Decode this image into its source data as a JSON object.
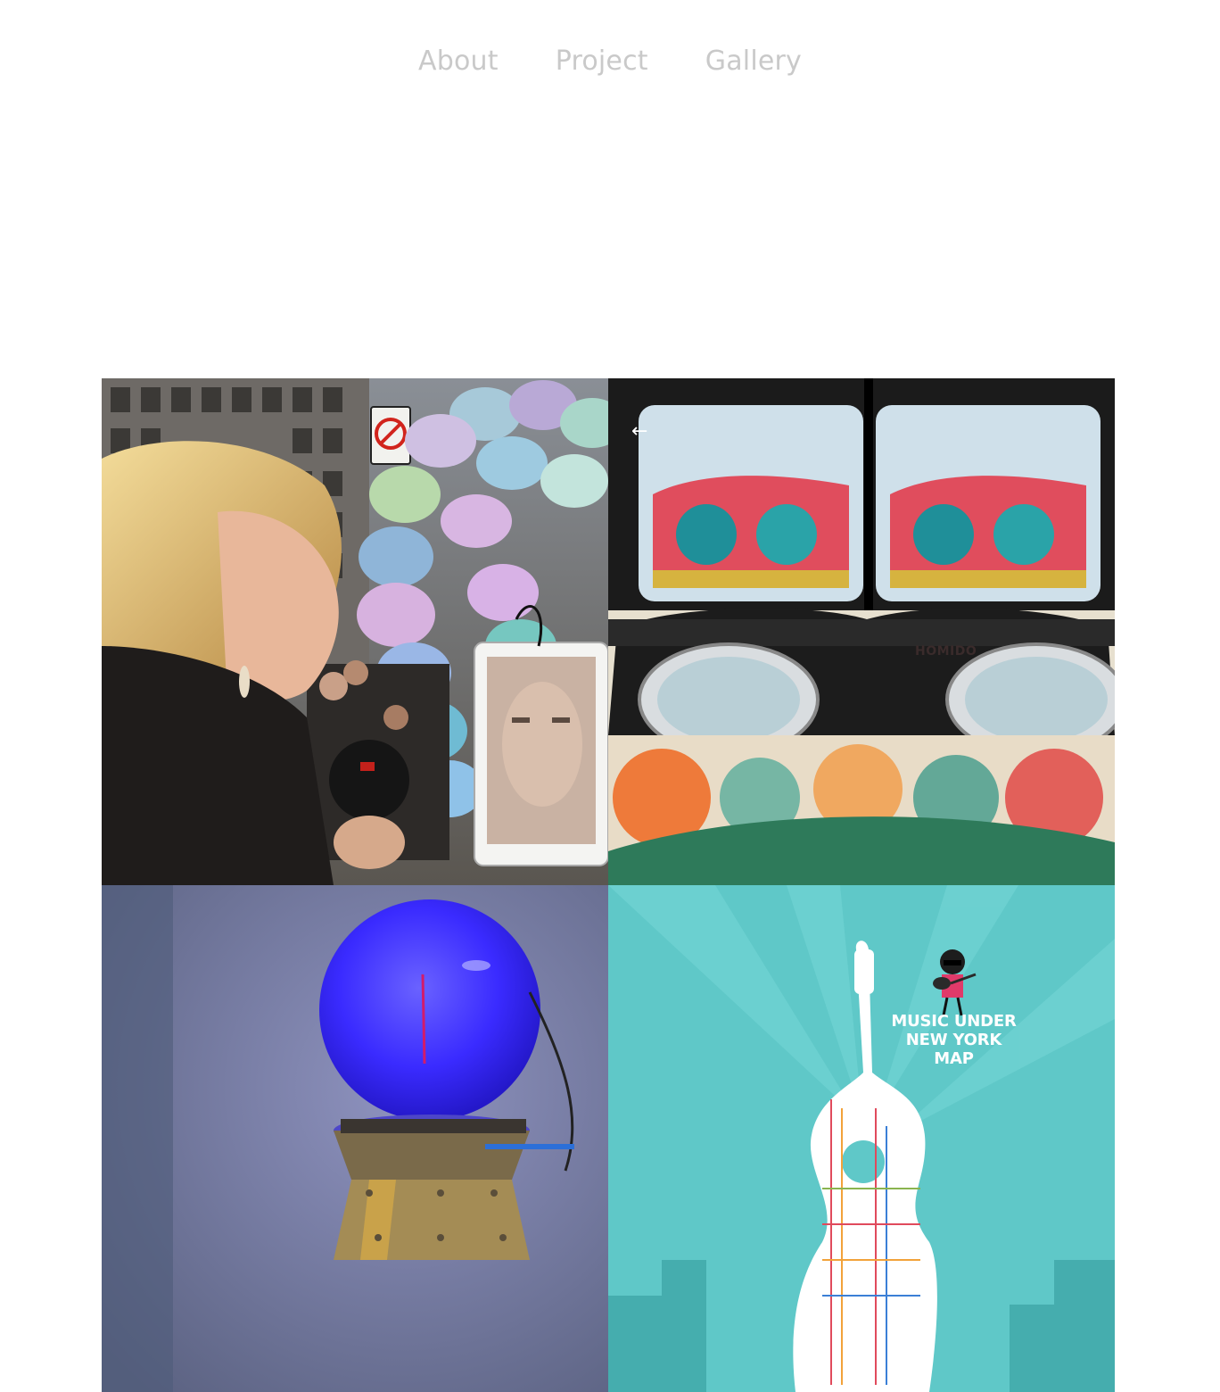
{
  "nav": {
    "links": [
      {
        "label": "About"
      },
      {
        "label": "Project"
      },
      {
        "label": "Gallery"
      }
    ]
  },
  "gallery": {
    "tiles": [
      {
        "kind": "street-installation-photo"
      },
      {
        "kind": "vr-headset-photo",
        "brand": "HOMIDO"
      },
      {
        "kind": "glowing-orb-photo"
      },
      {
        "kind": "poster",
        "title_lines": [
          "MUSIC UNDER",
          "NEW YORK",
          "MAP"
        ]
      }
    ]
  },
  "colors": {
    "nav_text": "#c9c9c9",
    "poster_teal": "#5fc8c8",
    "orb_blue": "#3a2bff"
  }
}
